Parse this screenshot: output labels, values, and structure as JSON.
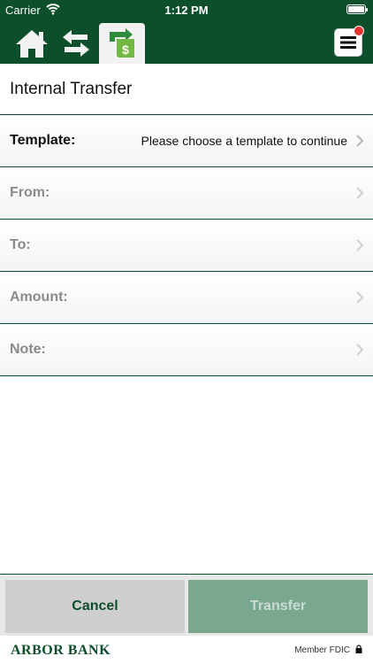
{
  "status_bar": {
    "carrier": "Carrier",
    "time": "1:12 PM"
  },
  "nav": {
    "icons": [
      "home-icon",
      "swap-arrows-icon",
      "transfer-dollar-icon",
      "hamburger-menu-icon"
    ],
    "notification_color": "#e53030"
  },
  "page": {
    "title": "Internal Transfer"
  },
  "form": {
    "template": {
      "label": "Template:",
      "value": "Please choose a template to continue"
    },
    "from": {
      "label": "From:",
      "value": ""
    },
    "to": {
      "label": "To:",
      "value": ""
    },
    "amount": {
      "label": "Amount:",
      "value": ""
    },
    "note": {
      "label": "Note:",
      "value": ""
    }
  },
  "actions": {
    "cancel_label": "Cancel",
    "transfer_label": "Transfer"
  },
  "footer": {
    "brand": "ARBOR BANK",
    "fdic": "Member FDIC"
  },
  "colors": {
    "brand_green": "#0d4f2a",
    "transfer_disabled": "#7aa790",
    "cancel_bg": "#cfcfcf"
  }
}
